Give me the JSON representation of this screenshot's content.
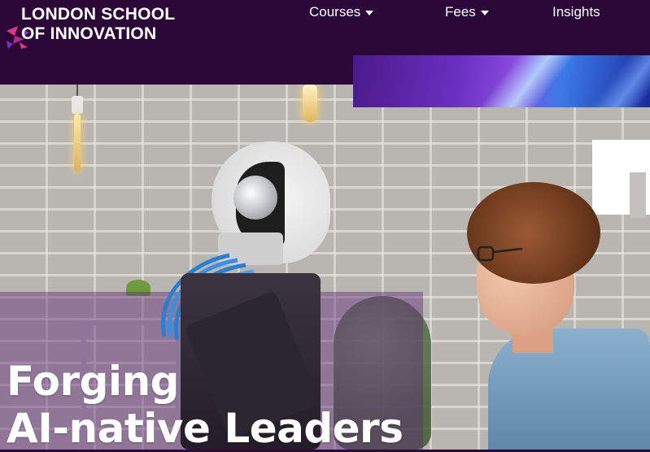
{
  "header": {
    "logo": {
      "line1": "LONDON SCHOOL",
      "line2": "OF INNOVATION"
    },
    "nav": [
      {
        "label": "Courses",
        "has_dropdown": true
      },
      {
        "label": "Fees",
        "has_dropdown": true
      },
      {
        "label": "Insights",
        "has_dropdown": false
      }
    ]
  },
  "hero": {
    "headline_line1": "Forging",
    "headline_line2": "AI-native Leaders"
  },
  "colors": {
    "header_bg": "#2c0838",
    "accent_magenta": "#b02a8a",
    "accent_purple": "#6a2fc0",
    "text_white": "#ffffff"
  },
  "icons": {
    "logo_mark": "geometric-arrow-logo",
    "dropdown": "caret-down-icon"
  }
}
